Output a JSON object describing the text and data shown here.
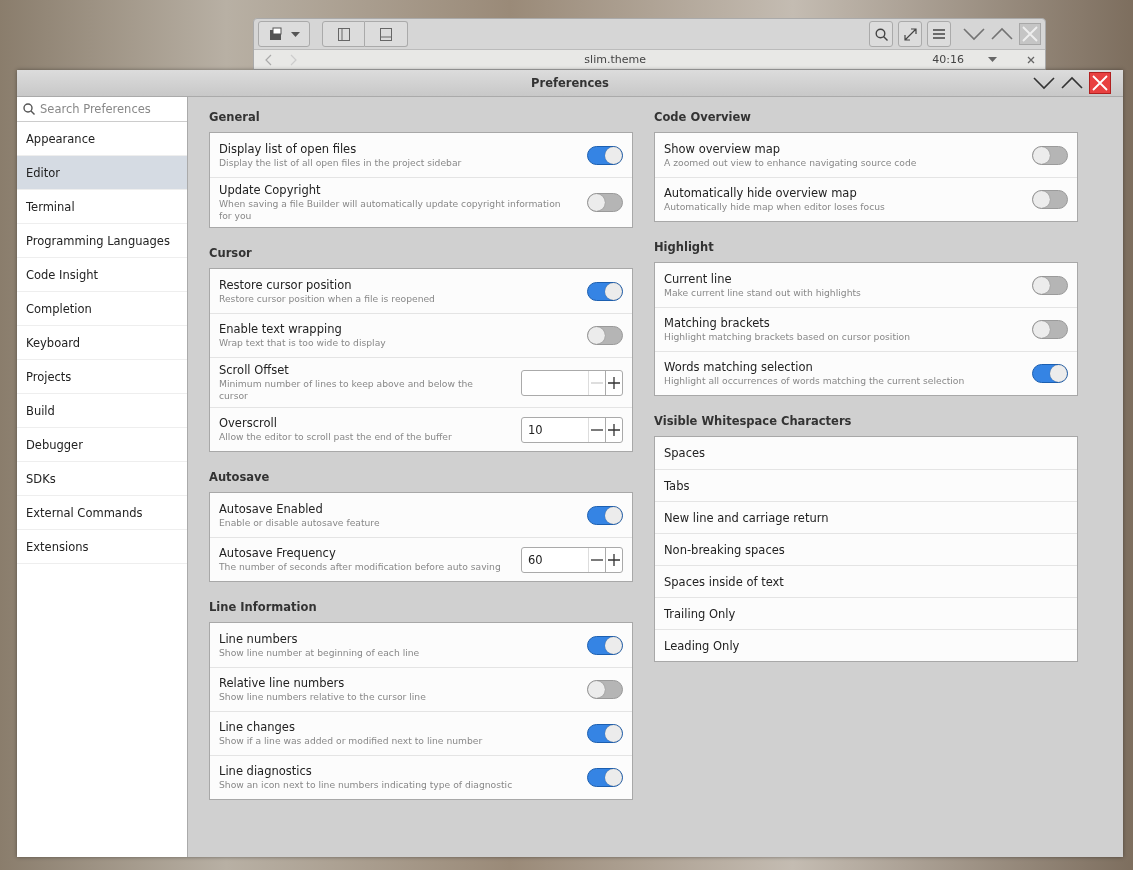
{
  "back_window": {
    "filename": "slim.theme",
    "position": "40:16"
  },
  "window": {
    "title": "Preferences"
  },
  "sidebar": {
    "search": {
      "placeholder": "Search Preferences"
    },
    "items": [
      {
        "label": "Appearance",
        "selected": false
      },
      {
        "label": "Editor",
        "selected": true
      },
      {
        "label": "Terminal",
        "selected": false
      },
      {
        "label": "Programming Languages",
        "selected": false
      },
      {
        "label": "Code Insight",
        "selected": false
      },
      {
        "label": "Completion",
        "selected": false
      },
      {
        "label": "Keyboard",
        "selected": false
      },
      {
        "label": "Projects",
        "selected": false
      },
      {
        "label": "Build",
        "selected": false
      },
      {
        "label": "Debugger",
        "selected": false
      },
      {
        "label": "SDKs",
        "selected": false
      },
      {
        "label": "External Commands",
        "selected": false
      },
      {
        "label": "Extensions",
        "selected": false
      }
    ]
  },
  "columns": [
    {
      "sections": [
        {
          "title": "General",
          "rows": [
            {
              "kind": "switch",
              "title": "Display list of open files",
              "subtitle": "Display the list of all open files in the project sidebar",
              "on": true
            },
            {
              "kind": "switch",
              "title": "Update Copyright",
              "subtitle": "When saving a file Builder will automatically update copyright information for you",
              "on": false
            }
          ]
        },
        {
          "title": "Cursor",
          "rows": [
            {
              "kind": "switch",
              "title": "Restore cursor position",
              "subtitle": "Restore cursor position when a file is reopened",
              "on": true
            },
            {
              "kind": "switch",
              "title": "Enable text wrapping",
              "subtitle": "Wrap text that is too wide to display",
              "on": false
            },
            {
              "kind": "spin",
              "title": "Scroll Offset",
              "subtitle": "Minimum number of lines to keep above and below the cursor",
              "minus_disabled": true
            },
            {
              "kind": "spin",
              "title": "Overscroll",
              "subtitle": "Allow the editor to scroll past the end of the buffer",
              "value": "10",
              "minus_disabled": false
            }
          ]
        },
        {
          "title": "Autosave",
          "rows": [
            {
              "kind": "switch",
              "title": "Autosave Enabled",
              "subtitle": "Enable or disable autosave feature",
              "on": true
            },
            {
              "kind": "spin",
              "title": "Autosave Frequency",
              "subtitle": "The number of seconds after modification before auto saving",
              "value": "60",
              "minus_disabled": false
            }
          ]
        },
        {
          "title": "Line Information",
          "rows": [
            {
              "kind": "switch",
              "title": "Line numbers",
              "subtitle": "Show line number at beginning of each line",
              "on": true
            },
            {
              "kind": "switch",
              "title": "Relative line numbers",
              "subtitle": "Show line numbers relative to the cursor line",
              "on": false
            },
            {
              "kind": "switch",
              "title": "Line changes",
              "subtitle": "Show if a line was added or modified next to line number",
              "on": true
            },
            {
              "kind": "switch",
              "title": "Line diagnostics",
              "subtitle": "Show an icon next to line numbers indicating type of diagnostic",
              "on": true
            }
          ]
        }
      ]
    },
    {
      "sections": [
        {
          "title": "Code Overview",
          "rows": [
            {
              "kind": "switch",
              "title": "Show overview map",
              "subtitle": "A zoomed out view to enhance navigating source code",
              "on": false
            },
            {
              "kind": "switch",
              "title": "Automatically hide overview map",
              "subtitle": "Automatically hide map when editor loses focus",
              "on": false
            }
          ]
        },
        {
          "title": "Highlight",
          "rows": [
            {
              "kind": "switch",
              "title": "Current line",
              "subtitle": "Make current line stand out with highlights",
              "on": false
            },
            {
              "kind": "switch",
              "title": "Matching brackets",
              "subtitle": "Highlight matching brackets based on cursor position",
              "on": false
            },
            {
              "kind": "switch",
              "title": "Words matching selection",
              "subtitle": "Highlight all occurrences of words matching the current selection",
              "on": true
            }
          ]
        },
        {
          "title": "Visible Whitespace Characters",
          "rows": [
            {
              "kind": "plain",
              "title": "Spaces"
            },
            {
              "kind": "plain",
              "title": "Tabs"
            },
            {
              "kind": "plain",
              "title": "New line and carriage return"
            },
            {
              "kind": "plain",
              "title": "Non-breaking spaces"
            },
            {
              "kind": "plain",
              "title": "Spaces inside of text"
            },
            {
              "kind": "plain",
              "title": "Trailing Only"
            },
            {
              "kind": "plain",
              "title": "Leading Only"
            }
          ]
        }
      ]
    }
  ]
}
